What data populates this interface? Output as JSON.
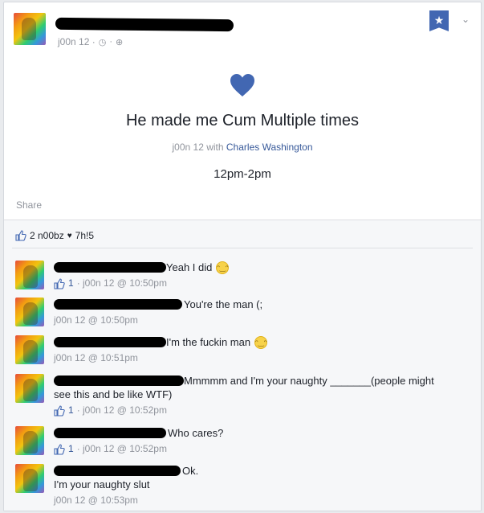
{
  "post": {
    "meta_text": "j00n 12 ·",
    "meta_icons": [
      "clock-icon",
      "globe-icon"
    ],
    "life_event": {
      "icon": "heart-icon",
      "title": "He made me Cum Multiple times",
      "sub_prefix": "j00n 12 with",
      "sub_with": "Charles Washington",
      "time": "12pm-2pm"
    },
    "share_label": "Share"
  },
  "reactions": {
    "likes_text": "2 n00bz",
    "heart_glyph": "♥",
    "loves_text": "7h!5"
  },
  "comments": [
    {
      "text": "Yeah I did",
      "emoji": ":)",
      "like_count": "1",
      "meta": "· j00n 12 @ 10:50pm"
    },
    {
      "text": "You're the man (;",
      "meta": "j00n 12 @ 10:50pm"
    },
    {
      "text": "I'm the fuckin man",
      "emoji": ":)",
      "meta": "j00n 12 @ 10:51pm"
    },
    {
      "text": "Mmmmm and I'm your naughty _______(people might",
      "text2": "see this and be like WTF)",
      "like_count": "1",
      "meta": "· j00n 12 @ 10:52pm"
    },
    {
      "text": "Who cares?",
      "like_count": "1",
      "meta": "· j00n 12 @ 10:52pm"
    },
    {
      "text": "Ok.",
      "text2": "I'm your naughty slut",
      "meta": "j00n 12 @ 10:53pm"
    }
  ],
  "colors": {
    "brand": "#4267b2",
    "link": "#365899",
    "muted": "#90949c",
    "heart": "#4267b2"
  }
}
